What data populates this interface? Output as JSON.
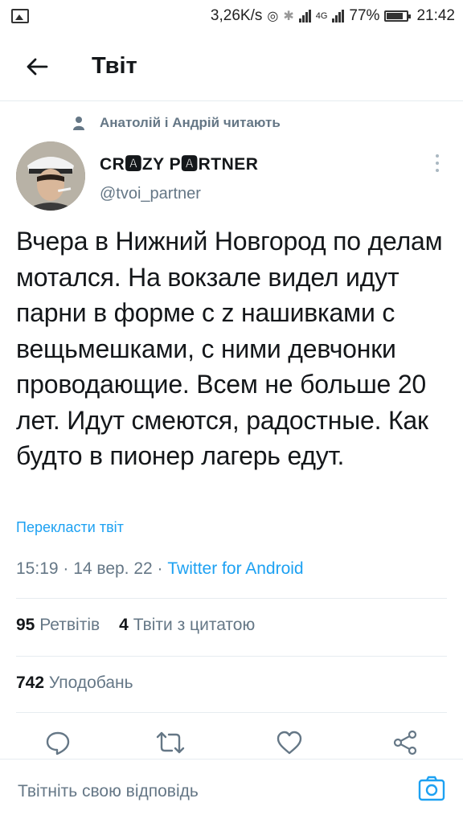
{
  "status_bar": {
    "speed": "3,26K/s",
    "network": "4G",
    "battery": "77%",
    "time": "21:42"
  },
  "header": {
    "title": "Твіт",
    "back_icon": "arrow-left-icon"
  },
  "tweet": {
    "social_context": "Анатолій і Андрій читають",
    "author_name": "CR🅰ZY P🅰RTNER",
    "handle": "@tvoi_partner",
    "text": "Вчера в Нижний Новгород по делам мотался. На вокзале видел идут парни в форме с z нашивками с вещьмешками, с ними девчонки проводающие. Всем не больше 20 лет. Идут смеются, радостные. Как будто в пионер лагерь едут.",
    "translate_label": "Перекласти твіт",
    "timestamp": "15:19 · 14 вер. 22 · ",
    "source": "Twitter for Android",
    "retweets_count": "95",
    "retweets_label": "Ретвітів",
    "quotes_count": "4",
    "quotes_label": "Твіти з цитатою",
    "likes_count": "742",
    "likes_label": "Уподобань"
  },
  "actions": [
    "reply-icon",
    "retweet-icon",
    "like-icon",
    "share-icon"
  ],
  "reply_bar": {
    "placeholder": "Твітніть свою відповідь",
    "camera_icon": "camera-icon"
  },
  "colors": {
    "accent": "#1da1f2",
    "secondary_text": "#657786",
    "divider": "#e6ecf0"
  }
}
